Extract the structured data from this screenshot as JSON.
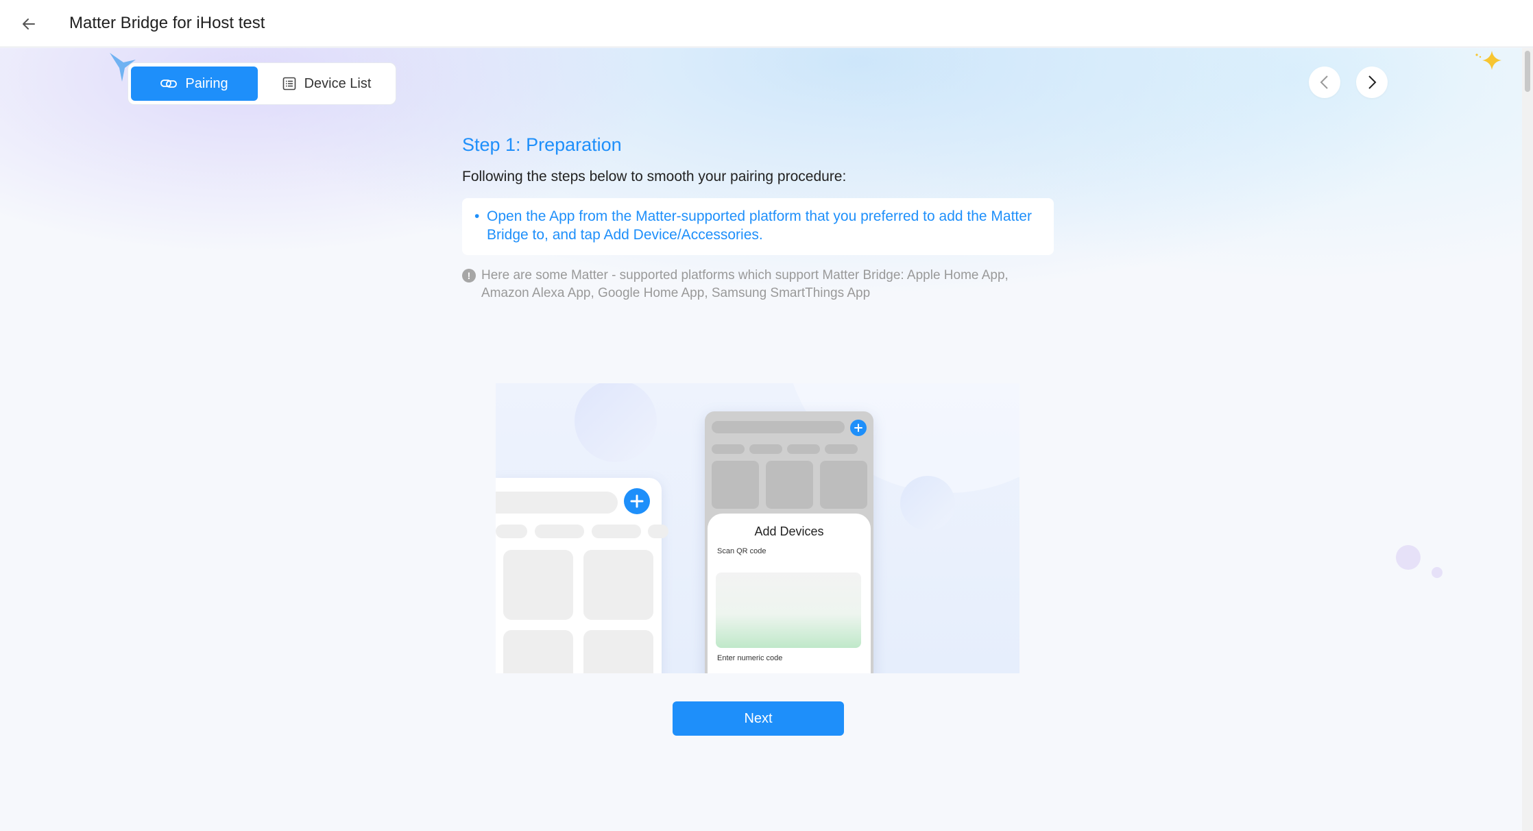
{
  "header": {
    "title": "Matter Bridge for iHost test",
    "back_icon": "arrow-left-icon"
  },
  "tabs": [
    {
      "label": "Pairing",
      "icon": "link-icon",
      "active": true
    },
    {
      "label": "Device List",
      "icon": "list-icon",
      "active": false
    }
  ],
  "nav": {
    "prev_icon": "chevron-left-icon",
    "next_icon": "chevron-right-icon"
  },
  "step": {
    "title": "Step 1: Preparation",
    "intro": "Following the steps below to smooth your pairing procedure:",
    "instructions": [
      "Open the App from the Matter-supported platform that you preferred to add the Matter Bridge to, and tap Add Device/Accessories."
    ],
    "hint": "Here are some Matter - supported platforms which support Matter Bridge: Apple Home App, Amazon Alexa App, Google Home App, Samsung SmartThings App"
  },
  "illustration": {
    "sheet_title": "Add Devices",
    "scan_label": "Scan QR code",
    "numeric_label": "Enter numeric code"
  },
  "actions": {
    "next_label": "Next"
  },
  "colors": {
    "accent": "#1e8ffa",
    "hint_text": "#999999",
    "sparkle_gold": "#f7c531",
    "sparkle_blue": "#5aa9f0"
  }
}
